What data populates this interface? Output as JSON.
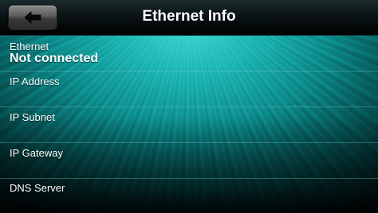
{
  "header": {
    "title": "Ethernet Info",
    "back_button": {
      "icon": "arrow-left-icon"
    }
  },
  "ethernet": {
    "label": "Ethernet",
    "status": "Not connected"
  },
  "fields": {
    "ip_address": "IP Address",
    "ip_subnet": "IP Subnet",
    "ip_gateway": "IP Gateway",
    "dns_server": "DNS Server"
  },
  "colors": {
    "accent": "#1db6b4",
    "background": "#000000",
    "text": "#ffffff"
  }
}
